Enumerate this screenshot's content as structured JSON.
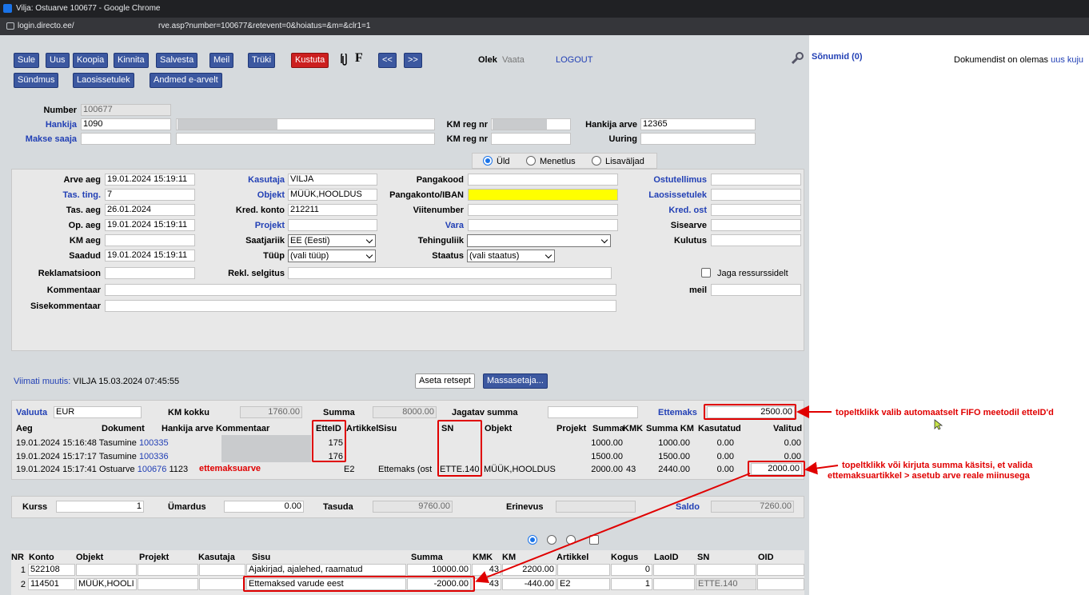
{
  "window": {
    "title": "Vilja: Ostuarve 100677 - Google Chrome",
    "host": "login.directo.ee/",
    "path": "rve.asp?number=100677&retevent=0&hoiatus=&m=&clr1=1"
  },
  "toolbar": {
    "buttons": [
      "Sule",
      "Uus",
      "Koopia",
      "Kinnita",
      "Salvesta",
      "Meil",
      "Trüki",
      "Kustuta"
    ],
    "f_label": "F",
    "prev": "<<",
    "next": ">>",
    "row2": [
      "Sündmus",
      "Laosissetulek",
      "Andmed e-arvelt"
    ],
    "olek_label": "Olek",
    "olek_value": "Vaata",
    "logout": "LOGOUT"
  },
  "right": {
    "messages": "Sõnumid (0)",
    "doc_text": "Dokumendist on olemas",
    "doc_link": "uus kuju"
  },
  "header": {
    "number_label": "Number",
    "number_value": "100677",
    "hankija_label": "Hankija",
    "hankija_value": "1090",
    "makse_label": "Makse saaja",
    "kmreg_label": "KM reg nr",
    "hankija_arve_label": "Hankija arve",
    "hankija_arve_value": "12365",
    "uuring_label": "Uuring"
  },
  "tabs": {
    "uld": "Üld",
    "menetlus": "Menetlus",
    "lisavaljad": "Lisaväljad"
  },
  "form": {
    "arve_aeg_label": "Arve aeg",
    "arve_aeg": "19.01.2024 15:19:11",
    "tas_ting_label": "Tas. ting.",
    "tas_ting": "7",
    "tas_aeg_label": "Tas. aeg",
    "tas_aeg": "26.01.2024",
    "op_aeg_label": "Op. aeg",
    "op_aeg": "19.01.2024 15:19:11",
    "km_aeg_label": "KM aeg",
    "saadud_label": "Saadud",
    "saadud": "19.01.2024 15:19:11",
    "reklamatsioon_label": "Reklamatsioon",
    "kommentaar_label": "Kommentaar",
    "sisekommentaar_label": "Sisekommentaar",
    "kasutaja_label": "Kasutaja",
    "kasutaja": "VILJA",
    "objekt_label": "Objekt",
    "objekt": "MÜÜK,HOOLDUS",
    "kred_konto_label": "Kred. konto",
    "kred_konto": "212211",
    "projekt_label": "Projekt",
    "saatjariik_label": "Saatjariik",
    "saatjariik": "EE (Eesti)",
    "tuup_label": "Tüüp",
    "tuup": "(vali tüüp)",
    "rekl_label": "Rekl. selgitus",
    "pangakood_label": "Pangakood",
    "pangakonto_label": "Pangakonto/IBAN",
    "viitenumber_label": "Viitenumber",
    "vara_label": "Vara",
    "tehinguliik_label": "Tehinguliik",
    "staatus_label": "Staatus",
    "staatus": "(vali staatus)",
    "ostutellimus_label": "Ostutellimus",
    "laosissetulek_label": "Laosissetulek",
    "kred_ost_label": "Kred. ost",
    "sisearve_label": "Sisearve",
    "kulutus_label": "Kulutus",
    "jaga_label": "Jaga ressurssidelt",
    "meil_label": "meil"
  },
  "modified": {
    "label": "Viimati muutis:",
    "value": "VILJA 15.03.2024 07:45:55"
  },
  "mid_buttons": {
    "recept": "Aseta retsept",
    "mass": "Massasetaja..."
  },
  "prepay": {
    "valuuta_label": "Valuuta",
    "valuuta": "EUR",
    "km_kokku_label": "KM kokku",
    "km_kokku": "1760.00",
    "summa_label": "Summa",
    "summa": "8000.00",
    "jagatav_label": "Jagatav summa",
    "ettemaks_label": "Ettemaks",
    "ettemaks": "2500.00",
    "columns": [
      "Aeg",
      "Dokument",
      "Hankija arve",
      "Kommentaar",
      "EtteID",
      "Artikkel",
      "Sisu",
      "SN",
      "Objekt",
      "Projekt",
      "Summa",
      "KMK",
      "Summa KM",
      "Kasutatud",
      "Valitud"
    ],
    "rows": [
      {
        "aeg": "19.01.2024 15:16:48",
        "doc": "Tasumine",
        "doc_no": "100335",
        "hankija_arve": "",
        "comment": "",
        "etteid": "175",
        "artikkel": "",
        "sisu": "",
        "sn": "",
        "objekt": "",
        "summa": "1000.00",
        "kmk": "",
        "summa_km": "1000.00",
        "kasutatud": "0.00",
        "valitud": "0.00"
      },
      {
        "aeg": "19.01.2024 15:17:17",
        "doc": "Tasumine",
        "doc_no": "100336",
        "hankija_arve": "",
        "comment": "",
        "etteid": "176",
        "artikkel": "",
        "sisu": "",
        "sn": "",
        "objekt": "",
        "summa": "1500.00",
        "kmk": "",
        "summa_km": "1500.00",
        "kasutatud": "0.00",
        "valitud": "0.00"
      },
      {
        "aeg": "19.01.2024 15:17:41",
        "doc": "Ostuarve",
        "doc_no": "100676",
        "hankija_arve": "1123",
        "comment": "ettemaksuarve",
        "etteid": "",
        "artikkel": "E2",
        "sisu": "Ettemaks (ost",
        "sn": "ETTE.140",
        "objekt": "MÜÜK,HOOLDUS",
        "summa": "2000.00",
        "kmk": "43",
        "summa_km": "2440.00",
        "kasutatud": "0.00",
        "valitud": "2000.00"
      }
    ],
    "kurss_label": "Kurss",
    "kurss": "1",
    "umardus_label": "Ümardus",
    "umardus": "0.00",
    "tasuda_label": "Tasuda",
    "tasuda": "9760.00",
    "erinevus_label": "Erinevus",
    "saldo_label": "Saldo",
    "saldo": "7260.00"
  },
  "notes": {
    "n1": "topeltklikk valib automaatselt FIFO meetodil etteID'd",
    "n2a": "topeltklikk või kirjuta summa käsitsi, et valida",
    "n2b": "ettemaksuartikkel > asetub arve reale miinusega"
  },
  "lines": {
    "columns": [
      "NR",
      "Konto",
      "Objekt",
      "Projekt",
      "Kasutaja",
      "Sisu",
      "Summa",
      "KMK",
      "KM",
      "Artikkel",
      "Kogus",
      "LaoID",
      "SN",
      "OID"
    ],
    "rows": [
      {
        "nr": "1",
        "konto": "522108",
        "objekt": "",
        "sisu": "Ajakirjad, ajalehed, raamatud",
        "summa": "10000.00",
        "kmk": "43",
        "km": "2200.00",
        "artikkel": "",
        "kogus": "0",
        "sn": ""
      },
      {
        "nr": "2",
        "konto": "114501",
        "objekt": "MÜÜK,HOOLI",
        "sisu": "Ettemaksed varude eest",
        "summa": "-2000.00",
        "kmk": "43",
        "km": "-440.00",
        "artikkel": "E2",
        "kogus": "1",
        "sn": "ETTE.140"
      }
    ]
  }
}
